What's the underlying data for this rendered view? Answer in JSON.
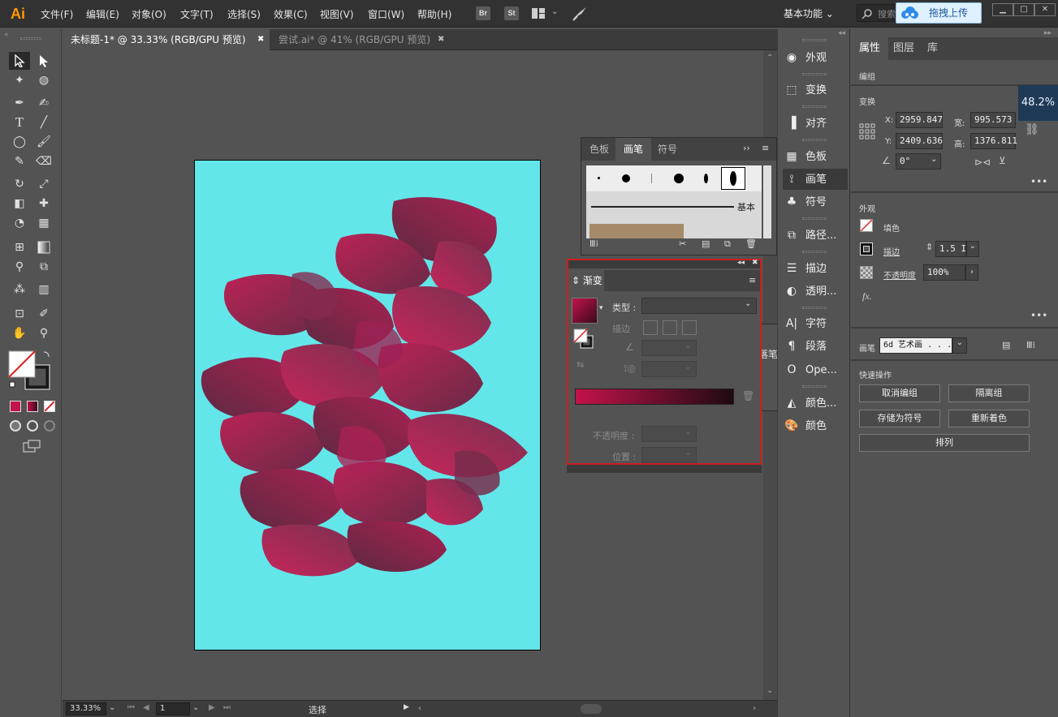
{
  "app": {
    "logo": "Ai",
    "workspace": "基本功能",
    "search_placeholder": "搜索",
    "upload_label": "拖拽上传",
    "zoom_badge": "48.2%"
  },
  "menu": [
    "文件(F)",
    "编辑(E)",
    "对象(O)",
    "文字(T)",
    "选择(S)",
    "效果(C)",
    "视图(V)",
    "窗口(W)",
    "帮助(H)"
  ],
  "menu_icons": {
    "br": "Br",
    "st": "St"
  },
  "tabs": [
    {
      "label": "未标题-1* @ 33.33% (RGB/GPU 预览)",
      "active": true
    },
    {
      "label": "尝试.ai* @ 41% (RGB/GPU 预览)",
      "active": false
    }
  ],
  "status": {
    "zoom": "33.33%",
    "page": "1",
    "tool": "选择"
  },
  "dock": [
    "外观",
    "变换",
    "对齐",
    "色板",
    "画笔",
    "符号",
    "路径...",
    "描边",
    "透明...",
    "字符",
    "段落",
    "Ope...",
    "颜色...",
    "颜色"
  ],
  "props": {
    "tabs": [
      "属性",
      "图层",
      "库"
    ],
    "group_label": "编组",
    "transform_title": "变换",
    "x_label": "X:",
    "x": "2959.847",
    "y_label": "Y:",
    "y": "2409.636",
    "w_label": "宽:",
    "w": "995.573",
    "h_label": "高:",
    "h": "1376.811",
    "angle": "0°",
    "appearance_title": "外观",
    "fill_label": "填色",
    "stroke_label": "描边",
    "stroke_weight": "1.5 I",
    "opacity_label": "不透明度",
    "opacity": "100%",
    "fx_label": "fx.",
    "brush_label": "画笔",
    "brush_value": "6d 艺术画 . . .",
    "quick_title": "快速操作",
    "btn_ungroup": "取消编组",
    "btn_isolate": "隔离组",
    "btn_save_symbol": "存储为符号",
    "btn_recolor": "重新着色",
    "btn_arrange": "排列"
  },
  "brush_panel": {
    "tabs": [
      "色板",
      "画笔",
      "符号"
    ],
    "basic_label": "基本"
  },
  "gradient_panel": {
    "title": "渐变",
    "type_label": "类型 :",
    "stroke_label": "描边",
    "opacity_label": "不透明度 :",
    "position_label": "位置 :"
  },
  "char_panel": {
    "label": "落笔"
  },
  "colors": {
    "accent_red": "#cc1f1f",
    "artboard": "#63e6e9",
    "petal_dark": "#6a1a3a",
    "petal_light": "#c2134a"
  }
}
